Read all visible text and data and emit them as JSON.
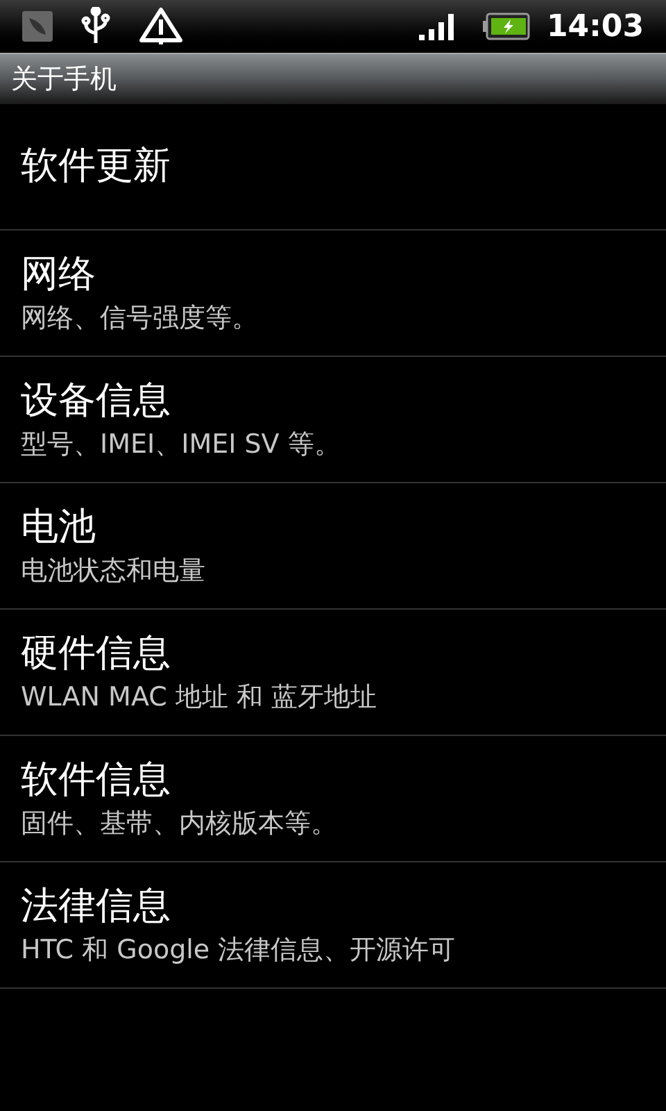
{
  "status_bar": {
    "time": "14:03"
  },
  "title_bar": {
    "title": "关于手机"
  },
  "items": [
    {
      "title": "软件更新"
    },
    {
      "title": "网络",
      "summary": "网络、信号强度等。"
    },
    {
      "title": "设备信息",
      "summary": "型号、IMEI、IMEI SV 等。"
    },
    {
      "title": "电池",
      "summary": "电池状态和电量"
    },
    {
      "title": "硬件信息",
      "summary": "WLAN MAC 地址 和 蓝牙地址"
    },
    {
      "title": "软件信息",
      "summary": "固件、基带、内核版本等。"
    },
    {
      "title": "法律信息",
      "summary": "HTC 和 Google 法律信息、开源许可"
    }
  ]
}
